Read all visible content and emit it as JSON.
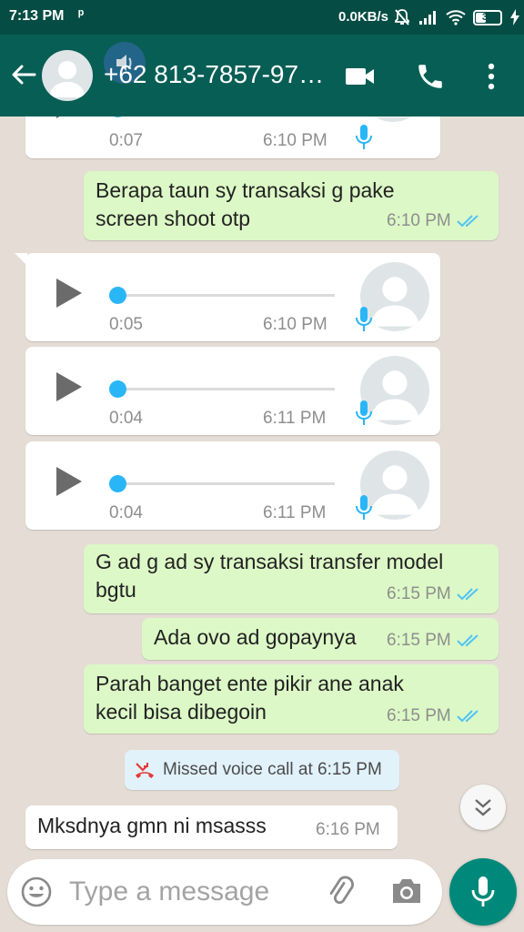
{
  "status_bar": {
    "time": "7:13 PM",
    "network_speed": "0.0KB/s",
    "battery_level": "33",
    "icons": [
      "p-glyph-icon",
      "mute-bell-icon",
      "signal-icon",
      "wifi-icon",
      "battery-icon",
      "charging-icon"
    ]
  },
  "header": {
    "contact_name": "+62 813-7857-97…",
    "icons": [
      "back-arrow-icon",
      "contact-avatar",
      "speaker-overlay-icon",
      "video-call-icon",
      "phone-call-icon",
      "more-vert-icon"
    ]
  },
  "messages": [
    {
      "type": "voice",
      "direction": "in",
      "duration": "0:07",
      "time": "6:10 PM"
    },
    {
      "type": "text",
      "direction": "out",
      "lines": [
        "Berapa taun sy transaksi g pake",
        "screen shoot otp"
      ],
      "time": "6:10 PM",
      "status": "read"
    },
    {
      "type": "voice",
      "direction": "in",
      "duration": "0:05",
      "time": "6:10 PM"
    },
    {
      "type": "voice",
      "direction": "in",
      "duration": "0:04",
      "time": "6:11 PM"
    },
    {
      "type": "voice",
      "direction": "in",
      "duration": "0:04",
      "time": "6:11 PM"
    },
    {
      "type": "text",
      "direction": "out",
      "lines": [
        "G ad g ad sy transaksi transfer model",
        "bgtu"
      ],
      "time": "6:15 PM",
      "status": "read"
    },
    {
      "type": "text",
      "direction": "out",
      "lines": [
        "Ada ovo ad gopaynya"
      ],
      "time": "6:15 PM",
      "status": "read"
    },
    {
      "type": "text",
      "direction": "out",
      "lines": [
        "Parah banget ente pikir ane anak",
        "kecil bisa dibegoin"
      ],
      "time": "6:15 PM",
      "status": "read"
    },
    {
      "type": "system",
      "text": "Missed voice call at 6:15 PM"
    },
    {
      "type": "text",
      "direction": "in",
      "lines": [
        "Mksdnya gmn ni msasss"
      ],
      "time": "6:16 PM"
    }
  ],
  "composer": {
    "placeholder": "Type a message",
    "icons": [
      "emoji-icon",
      "attach-icon",
      "camera-icon",
      "mic-icon"
    ]
  },
  "colors": {
    "status_bar": "#054d44",
    "app_bar": "#075e54",
    "chat_background": "#e5ddd5",
    "outgoing_bubble": "#dcf8c6",
    "incoming_bubble": "#ffffff",
    "read_ticks": "#4fc3f7",
    "voice_accent": "#29b6f6",
    "mic_button": "#00897b",
    "missed_call_icon": "#e53935",
    "system_bubble": "#e1f2fb"
  }
}
